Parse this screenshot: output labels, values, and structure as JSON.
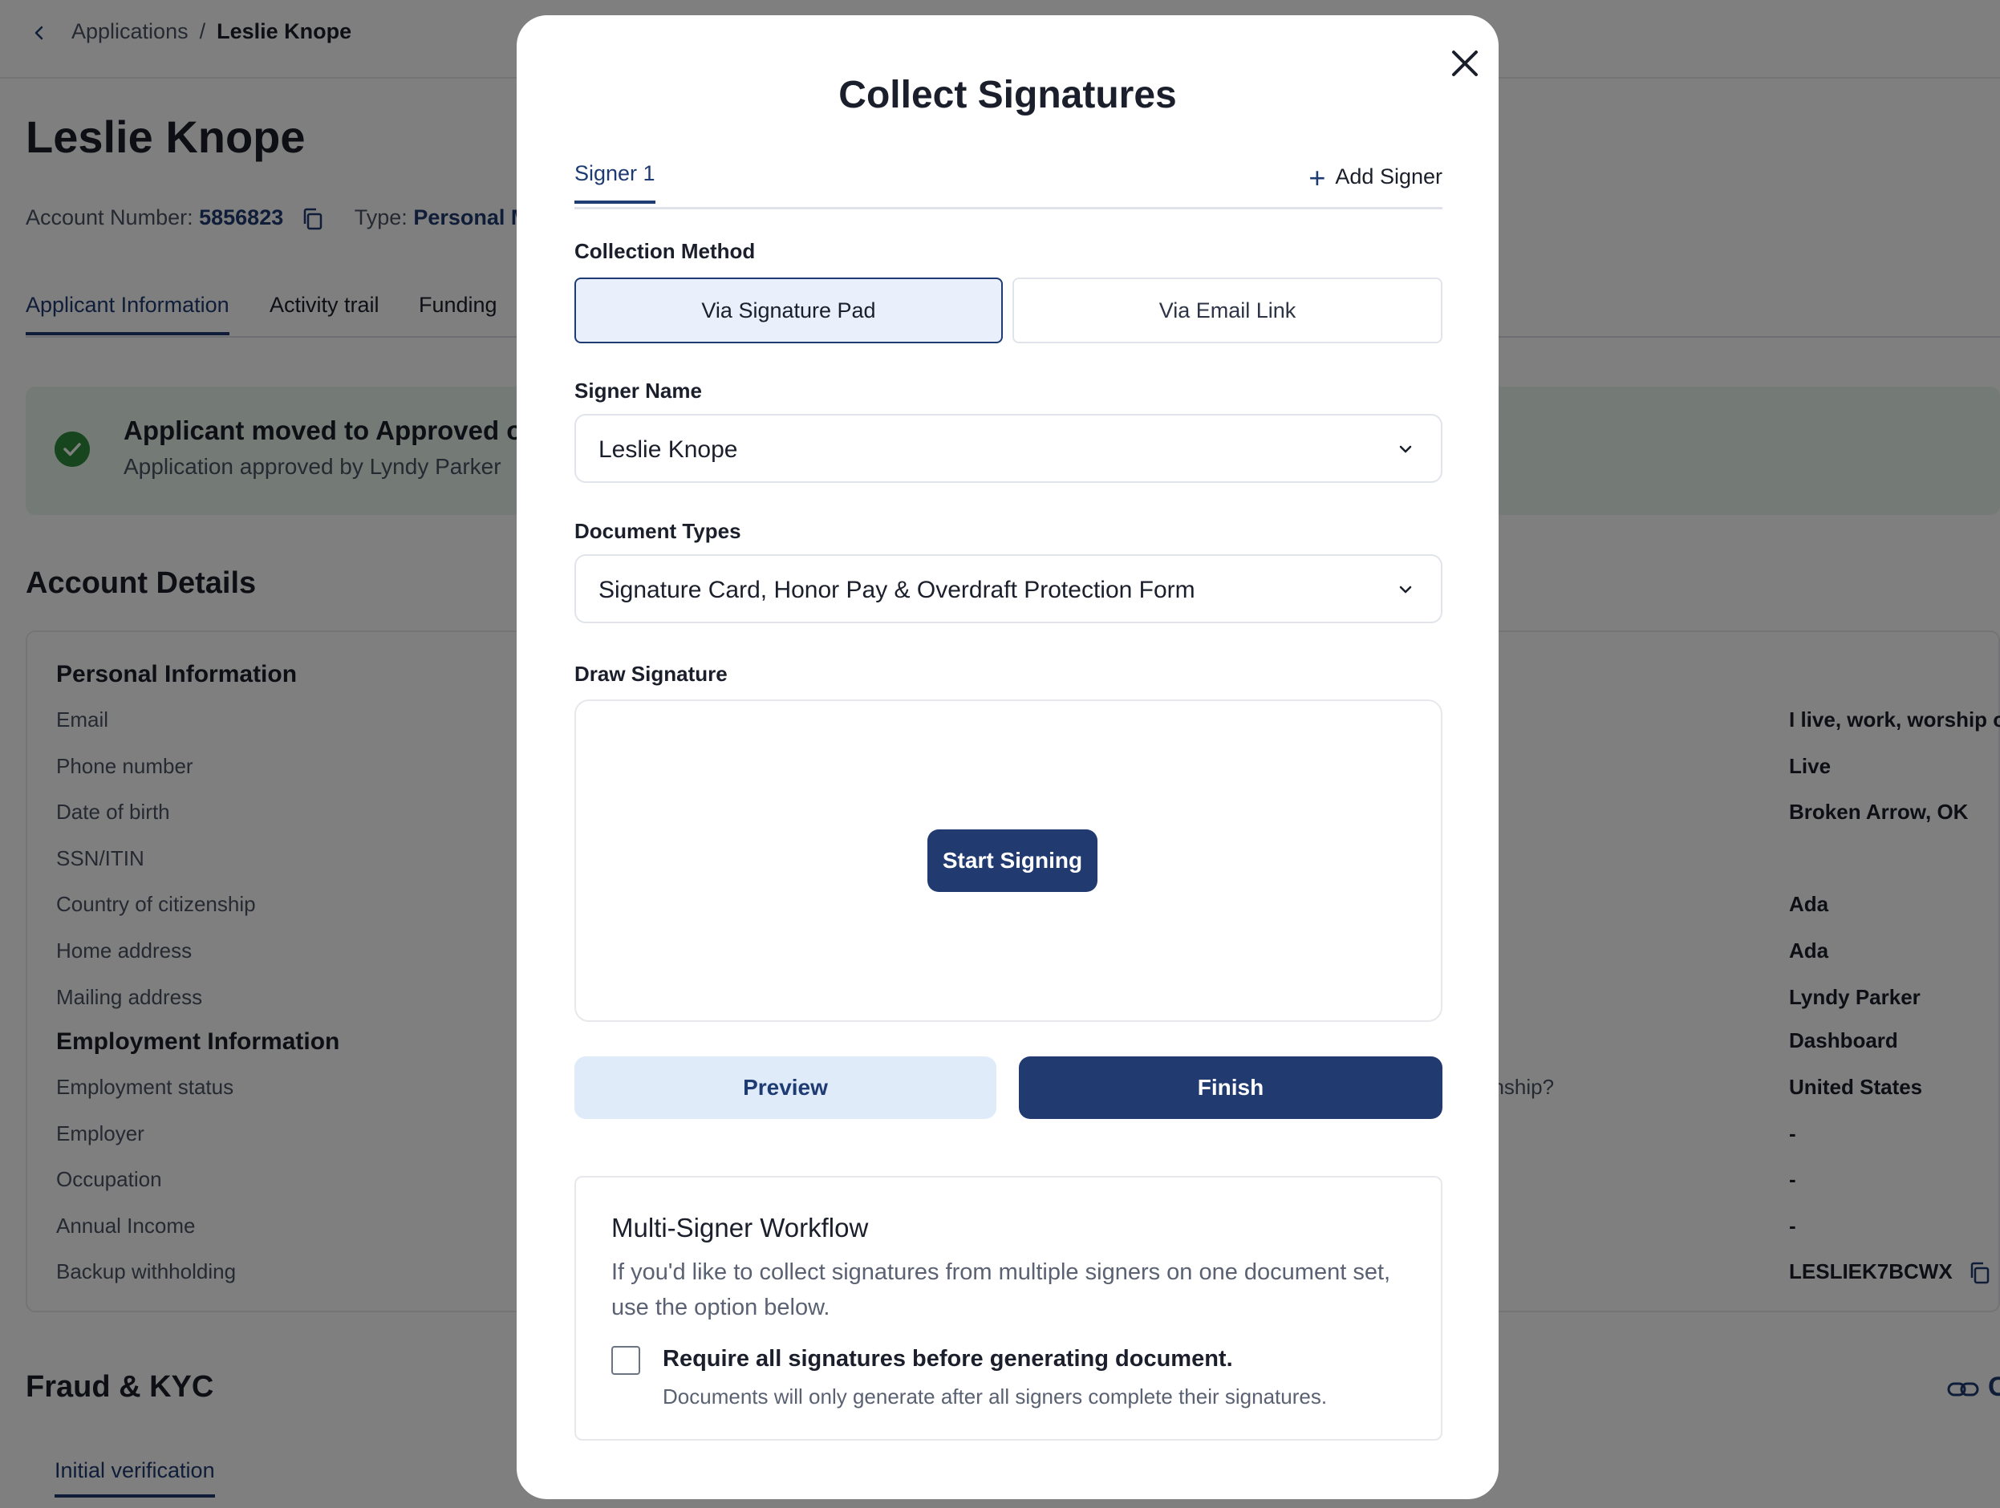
{
  "breadcrumb": {
    "parent": "Applications",
    "separator": "/",
    "current": "Leslie Knope"
  },
  "page": {
    "title": "Leslie Knope",
    "account_number_label": "Account Number:",
    "account_number": "5856823",
    "type_label": "Type:",
    "type_value": "Personal Me"
  },
  "tabs": [
    "Applicant Information",
    "Activity trail",
    "Funding"
  ],
  "banner": {
    "title": "Applicant moved to Approved on",
    "subtitle": "Application approved by Lyndy Parker"
  },
  "account_details": {
    "heading": "Account Details",
    "personal_heading": "Personal Information",
    "personal_labels": [
      "Email",
      "Phone number",
      "Date of birth",
      "SSN/ITIN",
      "Country of citizenship",
      "Home address",
      "Mailing address"
    ],
    "employment_heading": "Employment Information",
    "employment_labels": [
      "Employment status",
      "Employer",
      "Occupation",
      "Annual Income",
      "Backup withholding"
    ],
    "right_question": "enship?",
    "right_values": [
      "I live, work, worship or a",
      "Live",
      "Broken Arrow, OK",
      "Ada",
      "Ada",
      "Lyndy Parker",
      "Dashboard",
      "United States",
      "-",
      "-",
      "-",
      "LESLIEK7BCWX"
    ]
  },
  "fraud": {
    "heading": "Fraud & KYC",
    "link_fragment": "C",
    "tab": "Initial verification"
  },
  "modal": {
    "title": "Collect Signatures",
    "signer_tab": "Signer 1",
    "add_signer": "Add Signer",
    "collection_method_label": "Collection Method",
    "methods": [
      "Via Signature Pad",
      "Via Email Link"
    ],
    "selected_method": "Via Signature Pad",
    "signer_name_label": "Signer Name",
    "signer_name": "Leslie Knope",
    "document_types_label": "Document Types",
    "document_types": "Signature Card, Honor Pay & Overdraft Protection Form",
    "draw_signature_label": "Draw Signature",
    "start_signing": "Start Signing",
    "preview": "Preview",
    "finish": "Finish",
    "multi_signer": {
      "title": "Multi-Signer Workflow",
      "description": "If you'd like to collect signatures from multiple signers on one document set, use the option below.",
      "checkbox_label": "Require all signatures before generating document.",
      "checkbox_help": "Documents will only generate after all signers complete their signatures.",
      "checked": false
    }
  },
  "colors": {
    "primary": "#213a70",
    "primary_light": "#e0ebfa",
    "success": "#2e8b3a",
    "banner_bg": "#e9f5ea"
  }
}
